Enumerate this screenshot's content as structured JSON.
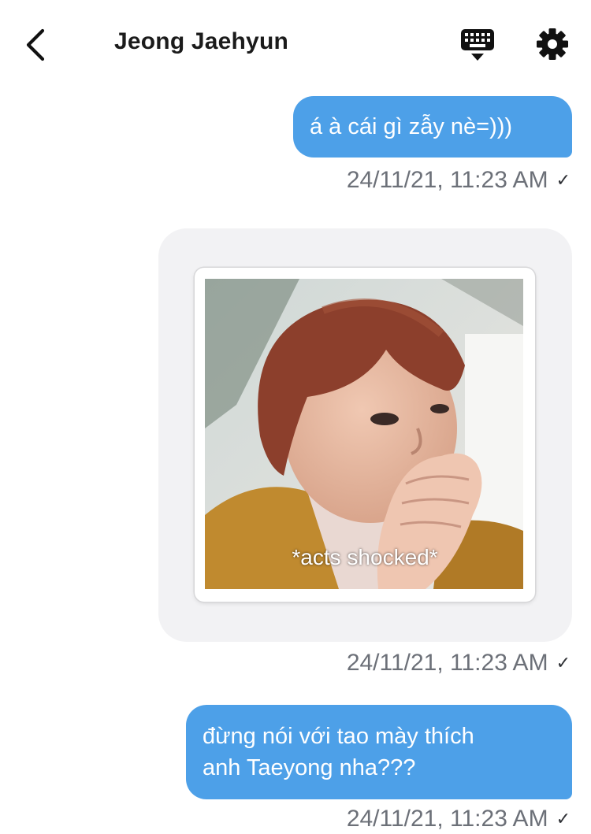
{
  "header": {
    "title": "Jeong Jaehyun",
    "back_icon": "chevron-left-icon",
    "keyboard_icon": "keyboard-icon",
    "settings_icon": "gear-icon"
  },
  "messages": [
    {
      "text": "á à cái gì zẫy nè=)))",
      "timestamp": "24/11/21, 11:23 AM",
      "status": "✓"
    },
    {
      "sticker_caption": "*acts shocked*",
      "timestamp": "24/11/21, 11:23 AM",
      "status": "✓"
    },
    {
      "lines": [
        "đừng nói với tao mày thích",
        "anh Taeyong nha???"
      ],
      "timestamp": "24/11/21, 11:23 AM",
      "status": "✓"
    }
  ],
  "colors": {
    "bubble": "#4da0e8",
    "timestamp": "#6c7078",
    "sticker_background": "#f2f2f4"
  }
}
